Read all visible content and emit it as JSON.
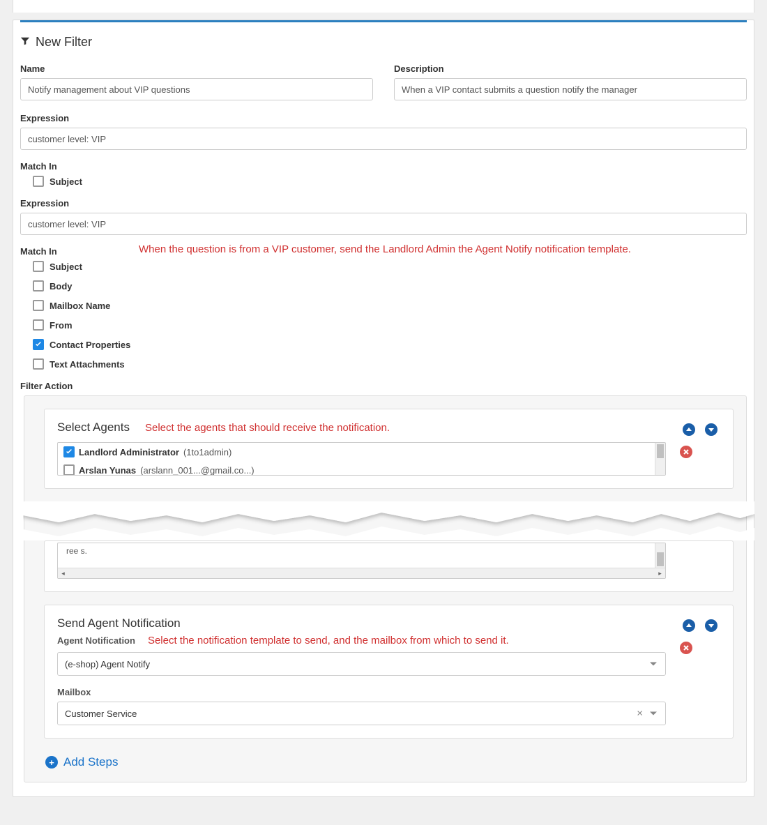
{
  "header": {
    "title": "New Filter"
  },
  "fields": {
    "name_label": "Name",
    "name_value": "Notify management about VIP questions",
    "desc_label": "Description",
    "desc_value": "When a VIP contact submits a question notify the manager",
    "expr1_label": "Expression",
    "expr1_value": "customer level: VIP",
    "matchin1_label": "Match In",
    "matchin1_subject": "Subject",
    "expr2_label": "Expression",
    "expr2_value": "customer level: VIP",
    "matchin2_label": "Match In",
    "matchin2_items": {
      "subject": "Subject",
      "body": "Body",
      "mailbox_name": "Mailbox Name",
      "from": "From",
      "contact_properties": "Contact Properties",
      "text_attachments": "Text Attachments"
    },
    "filter_action_label": "Filter Action"
  },
  "annotations": {
    "main": "When the question is from a VIP customer, send the Landlord Admin the Agent Notify notification template.",
    "select_agents": "Select the agents that should receive the notification.",
    "send_notif": "Select the notification template to send, and the mailbox from which to send it."
  },
  "select_agents": {
    "title": "Select Agents",
    "items": [
      {
        "name": "Landlord Administrator",
        "paren": "(1to1admin)",
        "checked": true
      },
      {
        "name": "Arslan Yunas",
        "paren": "(arslann_001...@gmail.co...)",
        "checked": false
      }
    ],
    "fragment": "ree                              s."
  },
  "send_notification": {
    "title": "Send Agent Notification",
    "agent_notif_label": "Agent Notification",
    "agent_notif_value": "(e-shop) Agent Notify",
    "mailbox_label": "Mailbox",
    "mailbox_value": "Customer Service"
  },
  "add_steps_label": "Add Steps"
}
